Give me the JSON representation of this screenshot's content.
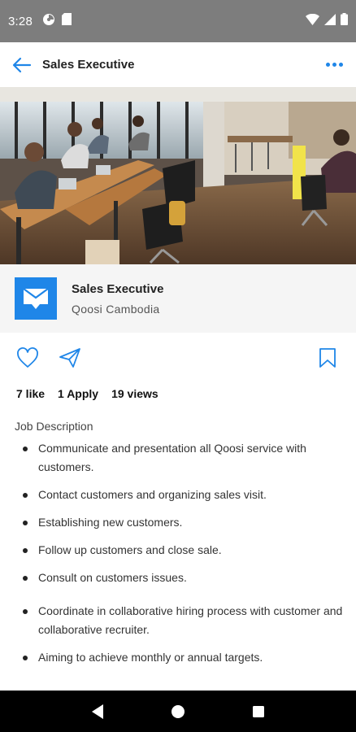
{
  "status_bar": {
    "time": "3:28",
    "left_icons": [
      "pie-chart-icon",
      "sd-card-icon"
    ],
    "right_icons": [
      "wifi-icon",
      "signal-icon",
      "battery-icon"
    ]
  },
  "app_bar": {
    "title": "Sales Executive",
    "back_icon": "back-arrow-icon",
    "more_icon": "more-dots-icon",
    "accent_color": "#1f86e8"
  },
  "hero": {
    "icon": "office-photo"
  },
  "company": {
    "job_title": "Sales Executive",
    "name": "Qoosi Cambodia",
    "logo_icon": "chat-envelope-icon"
  },
  "actions": {
    "like_icon": "heart-icon",
    "share_icon": "send-icon",
    "bookmark_icon": "bookmark-icon"
  },
  "stats": {
    "likes": "7 like",
    "applies": "1 Apply",
    "views": "19 views"
  },
  "description": {
    "title": "Job Description",
    "items": [
      "Communicate and presentation all Qoosi service with customers.",
      "Contact customers and organizing sales visit.",
      "Establishing new customers.",
      "Follow up customers and close sale.",
      "Consult on customers issues.",
      "Coordinate in collaborative hiring process with customer and collaborative recruiter.",
      "Aiming to achieve monthly or annual targets."
    ]
  },
  "nav_bar": {
    "icons": [
      "back-triangle-icon",
      "home-circle-icon",
      "recents-square-icon"
    ]
  }
}
